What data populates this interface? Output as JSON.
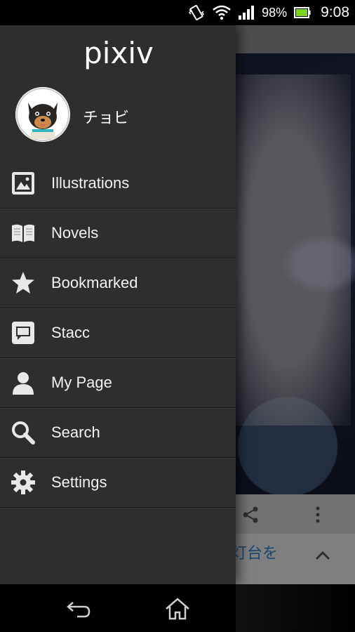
{
  "status_bar": {
    "battery_percent": "98%",
    "time": "9:08",
    "icons": [
      "vibrate-icon",
      "wifi-icon",
      "signal-icon",
      "battery-icon"
    ]
  },
  "drawer": {
    "logo_text": "pixiv",
    "username": "チョビ",
    "menu": [
      {
        "label": "Illustrations",
        "icon": "image-icon"
      },
      {
        "label": "Novels",
        "icon": "book-icon"
      },
      {
        "label": "Bookmarked",
        "icon": "star-icon"
      },
      {
        "label": "Stacc",
        "icon": "chat-icon"
      },
      {
        "label": "My Page",
        "icon": "person-icon"
      },
      {
        "label": "Search",
        "icon": "search-icon"
      },
      {
        "label": "Settings",
        "icon": "gear-icon"
      }
    ]
  },
  "background": {
    "caption_fragment": "灯台を"
  },
  "navbar": {
    "icons": [
      "back-icon",
      "home-icon"
    ]
  },
  "colors": {
    "drawer_bg": "#2e2e2e",
    "status_bar_bg": "#000000",
    "accent_link": "#2f7fd0"
  }
}
